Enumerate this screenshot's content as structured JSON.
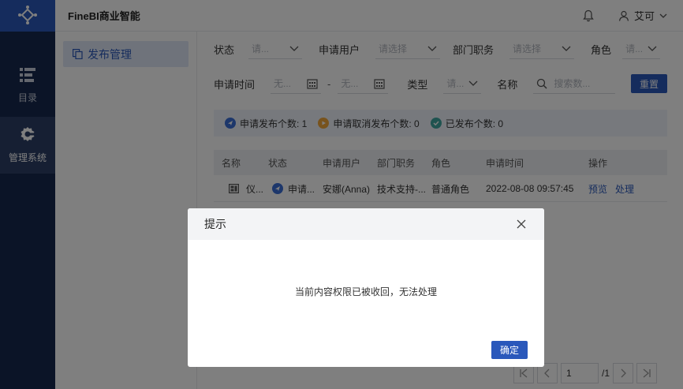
{
  "header": {
    "brand": "FineBI商业智能",
    "user_name": "艾可"
  },
  "leftnav": {
    "items": [
      {
        "label": "目录",
        "icon": "catalog-icon"
      },
      {
        "label": "管理系统",
        "icon": "gear-icon"
      }
    ]
  },
  "subnav": {
    "items": [
      {
        "label": "发布管理",
        "icon": "copy-icon"
      }
    ]
  },
  "filters": {
    "status_label": "状态",
    "status_value": "请...",
    "applicant_label": "申请用户",
    "applicant_placeholder": "请选择",
    "dept_label": "部门职务",
    "dept_placeholder": "请选择",
    "role_label": "角色",
    "role_value": "请...",
    "time_label": "申请时间",
    "time_start": "无...",
    "time_sep": "-",
    "time_end": "无...",
    "type_label": "类型",
    "type_value": "请...",
    "name_label": "名称",
    "search_placeholder": "搜索数...",
    "reset_label": "重置"
  },
  "stats": [
    {
      "label": "申请发布个数: 1",
      "color": "#3b6fd6"
    },
    {
      "label": "申请取消发布个数: 0",
      "color": "#f0a63a"
    },
    {
      "label": "已发布个数: 0",
      "color": "#3fa6a0"
    }
  ],
  "table": {
    "columns": [
      "名称",
      "状态",
      "申请用户",
      "部门职务",
      "角色",
      "申请时间",
      "操作"
    ],
    "rows": [
      {
        "name": "仪...",
        "status": "申请...",
        "user": "安娜(Anna)",
        "dept": "技术支持-...",
        "role": "普通角色",
        "time": "2022-08-08 09:57:45",
        "action_preview": "预览",
        "action_handle": "处理"
      }
    ]
  },
  "pager": {
    "page": "1",
    "total": "/1"
  },
  "modal": {
    "title": "提示",
    "message": "当前内容权限已被收回，无法处理",
    "ok_label": "确定"
  },
  "colors": {
    "primary": "#2a58bb",
    "nav_bg": "#16284f",
    "logo_bg": "#2a58bb"
  }
}
